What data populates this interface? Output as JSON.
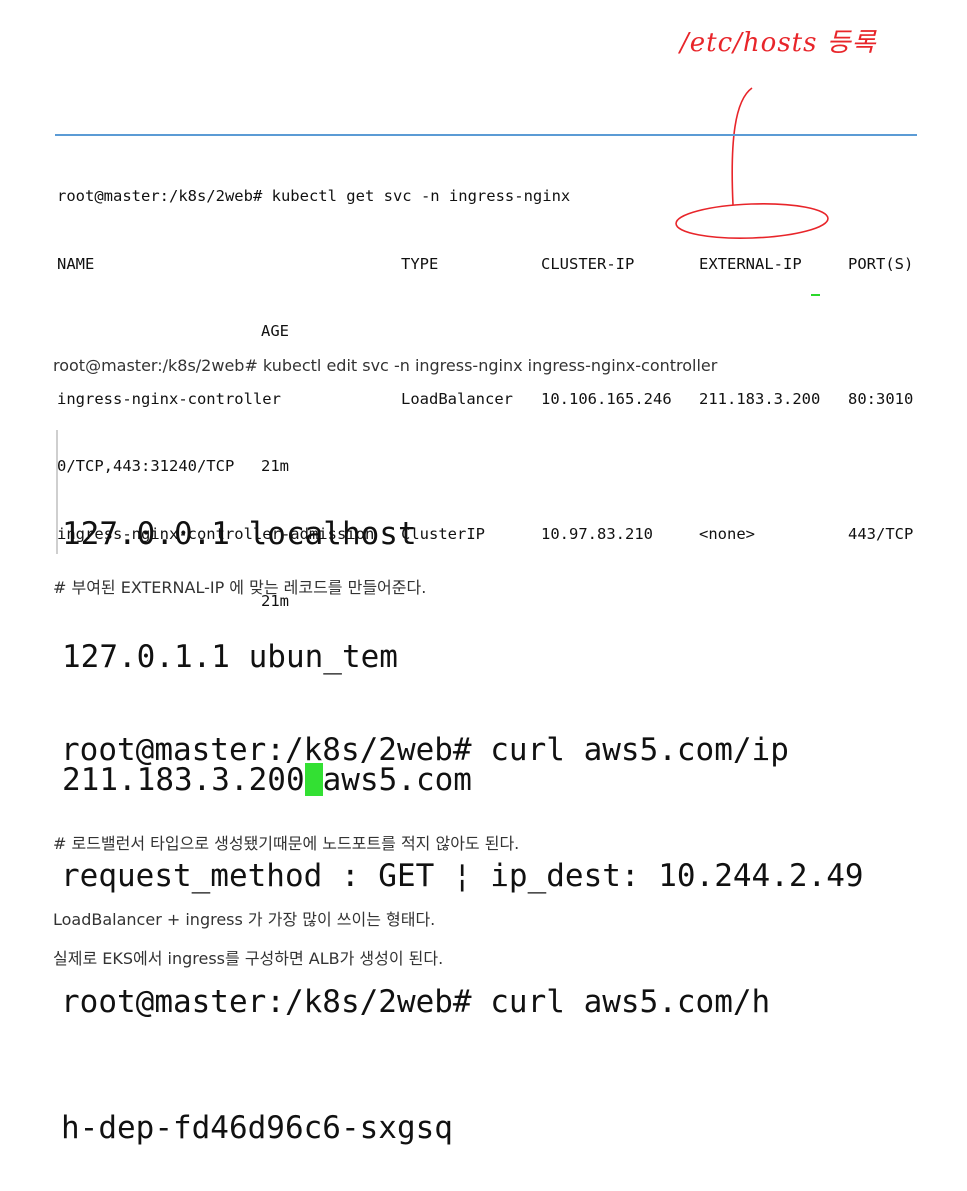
{
  "annotation": {
    "text": "/etc/hosts 등록",
    "color": "#e8252a"
  },
  "terminal1": {
    "prompt_line": "root@master:/k8s/2web# kubectl get svc -n ingress-nginx",
    "headers": {
      "name": "NAME",
      "type": "TYPE",
      "cluster_ip": "CLUSTER-IP",
      "external_ip": "EXTERNAL-IP",
      "ports": "PORT(S)",
      "age": "AGE"
    },
    "rows": [
      {
        "name": "ingress-nginx-controller",
        "type": "LoadBalancer",
        "cluster_ip": "10.106.165.246",
        "external_ip": "211.183.3.200",
        "ports_a": "80:3010",
        "ports_b": "0/TCP,443:31240/TCP",
        "age": "21m"
      },
      {
        "name": "ingress-nginx-controller-admission",
        "type": "ClusterIP",
        "cluster_ip": "10.97.83.210",
        "external_ip": "<none>",
        "ports_a": "443/TCP",
        "age": "21m"
      }
    ]
  },
  "edit_command": "root@master:/k8s/2web# kubectl edit svc -n ingress-nginx ingress-nginx-controller",
  "hosts": {
    "lines": [
      "127.0.0.1 localhost",
      "127.0.1.1 ubun_tem"
    ],
    "last_ip": "211.183.3.200",
    "last_host": "aws5.com"
  },
  "note_hosts": "# 부여된 EXTERNAL-IP 에 맞는 레코드를 만들어준다.",
  "curl_lines": [
    "root@master:/k8s/2web# curl aws5.com/ip",
    "request_method : GET ¦ ip_dest: 10.244.2.49",
    "root@master:/k8s/2web# curl aws5.com/h",
    "h-dep-fd46d96c6-sxgsq"
  ],
  "note_lb": "# 로드밸런서 타입으로 생성됐기때문에 노드포트를 적지 않아도 된다.",
  "paragraph1": "LoadBalancer + ingress 가 가장 많이 쓰이는 형태다.",
  "paragraph2": "실제로 EKS에서 ingress를 구성하면 ALB가 생성이 된다.",
  "cursor_color": "#33e033"
}
